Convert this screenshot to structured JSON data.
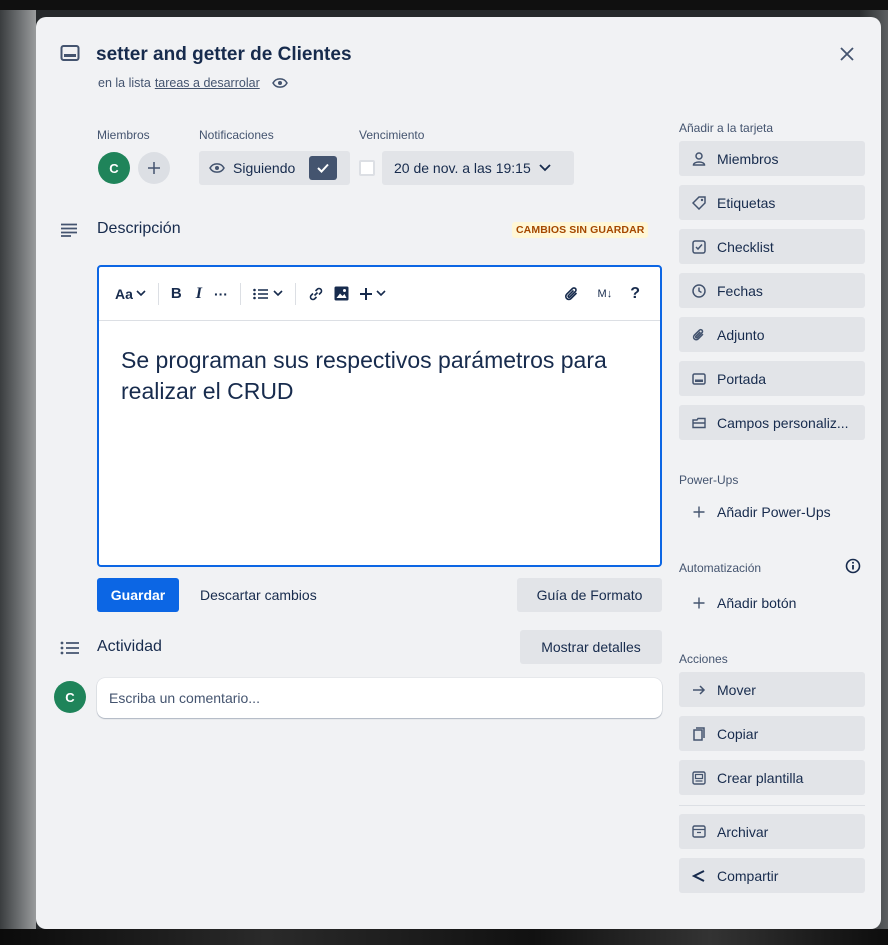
{
  "card": {
    "title": "setter and getter de Clientes",
    "in_list_prefix": "en la lista",
    "list_name": "tareas a desarrolar"
  },
  "members": {
    "label": "Miembros",
    "avatar_initial": "C"
  },
  "notifications": {
    "label": "Notificaciones",
    "watch_label": "Siguiendo"
  },
  "due": {
    "label": "Vencimiento",
    "date_text": "20 de nov. a las 19:15"
  },
  "description": {
    "title": "Descripción",
    "unsaved_badge": "CAMBIOS SIN GUARDAR",
    "text_style_label": "Aa",
    "bold_label": "B",
    "italic_label": "I",
    "more_label": "···",
    "markdown_label": "M↓",
    "help_label": "?",
    "content": "Se programan sus respectivos parámetros para realizar el CRUD"
  },
  "editor_actions": {
    "save_label": "Guardar",
    "discard_label": "Descartar cambios",
    "format_guide_label": "Guía de Formato"
  },
  "activity": {
    "title": "Actividad",
    "show_details_label": "Mostrar detalles",
    "avatar_initial": "C",
    "comment_placeholder": "Escriba un comentario..."
  },
  "sidebar": {
    "add_to_card_label": "Añadir a la tarjeta",
    "add_items": [
      {
        "label": "Miembros",
        "icon": "person-icon"
      },
      {
        "label": "Etiquetas",
        "icon": "tag-icon"
      },
      {
        "label": "Checklist",
        "icon": "checklist-icon"
      },
      {
        "label": "Fechas",
        "icon": "clock-icon"
      },
      {
        "label": "Adjunto",
        "icon": "paperclip-icon"
      },
      {
        "label": "Portada",
        "icon": "cover-icon"
      },
      {
        "label": "Campos personaliz...",
        "icon": "custom-fields-icon"
      }
    ],
    "powerups_label": "Power-Ups",
    "add_powerups_label": "Añadir Power-Ups",
    "automation_label": "Automatización",
    "add_button_label": "Añadir botón",
    "actions_label": "Acciones",
    "action_items": [
      {
        "label": "Mover",
        "icon": "arrow-right-icon"
      },
      {
        "label": "Copiar",
        "icon": "copy-icon"
      },
      {
        "label": "Crear plantilla",
        "icon": "template-icon"
      },
      {
        "label": "Archivar",
        "icon": "archive-icon"
      },
      {
        "label": "Compartir",
        "icon": "share-icon"
      }
    ]
  },
  "colors": {
    "accent": "#0c66e4",
    "avatar": "#1f845a",
    "unsaved_text": "#a54800",
    "unsaved_bg": "#fff7d6",
    "modal_bg": "#f1f2f4"
  }
}
